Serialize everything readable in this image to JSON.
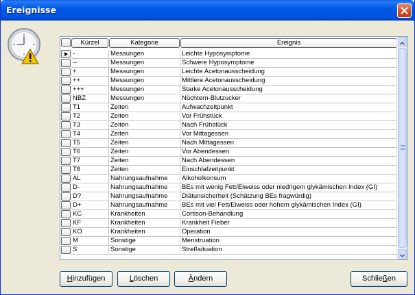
{
  "window": {
    "title": "Ereignisse"
  },
  "icons": {
    "dialog": "clock-warning-icon",
    "close": "close-icon",
    "row_pointer": "row-pointer-icon"
  },
  "table": {
    "columns": [
      "Kürzel",
      "Kategorie",
      "Ereignis"
    ],
    "current_row_index": 0,
    "rows": [
      {
        "code": "-",
        "category": "Messungen",
        "event": "Leichte Hyposymptome"
      },
      {
        "code": "--",
        "category": "Messungen",
        "event": "Schwere Hyposymptome"
      },
      {
        "code": "+",
        "category": "Messungen",
        "event": "Leichte Acetonausscheidung"
      },
      {
        "code": "++",
        "category": "Messungen",
        "event": "Mittlere Acetonausscheidung"
      },
      {
        "code": "+++",
        "category": "Messungen",
        "event": "Starke Acetonausscheidung"
      },
      {
        "code": "NBZ",
        "category": "Messungen",
        "event": "Nüchtern-Blutzucker"
      },
      {
        "code": "T1",
        "category": "Zeiten",
        "event": "Aufwachzeitpunkt"
      },
      {
        "code": "T2",
        "category": "Zeiten",
        "event": "Vor Frühstück"
      },
      {
        "code": "T3",
        "category": "Zeiten",
        "event": "Nach Frühstück"
      },
      {
        "code": "T4",
        "category": "Zeiten",
        "event": "Vor Mittagessen"
      },
      {
        "code": "T5",
        "category": "Zeiten",
        "event": "Nach Mittagessen"
      },
      {
        "code": "T6",
        "category": "Zeiten",
        "event": "Vor Abendessen"
      },
      {
        "code": "T7",
        "category": "Zeiten",
        "event": "Nach Abendessen"
      },
      {
        "code": "T8",
        "category": "Zeiten",
        "event": "Einschlafzeitpunkt"
      },
      {
        "code": "AL",
        "category": "Nahrungsaufnahme",
        "event": "Alkoholkonsum"
      },
      {
        "code": "D-",
        "category": "Nahrungsaufnahme",
        "event": "BEs mit wenig Fett/Eiweiss oder niedrigem glykämischen Index (GI)"
      },
      {
        "code": "D?",
        "category": "Nahrungsaufnahme",
        "event": "Diätunsicherheit (Schätzung BEs fragwürdig)"
      },
      {
        "code": "D+",
        "category": "Nahrungsaufnahme",
        "event": "BEs mit viel Fett/Eiweiss oder hohem glykämischen Index (GI)"
      },
      {
        "code": "KC",
        "category": "Krankheiten",
        "event": "Cortison-Behandlung"
      },
      {
        "code": "KF",
        "category": "Krankheiten",
        "event": "Krankheit Fieber"
      },
      {
        "code": "KO",
        "category": "Krankheiten",
        "event": "Operation"
      },
      {
        "code": "M",
        "category": "Sonstige",
        "event": "Menstruation"
      },
      {
        "code": "S",
        "category": "Sonstige",
        "event": "Streßsituation"
      }
    ]
  },
  "buttons": {
    "add": {
      "pre": "",
      "hot": "H",
      "post": "inzufügen"
    },
    "delete": {
      "pre": "",
      "hot": "L",
      "post": "öschen"
    },
    "edit": {
      "pre": "",
      "hot": "Ä",
      "post": "ndern"
    },
    "close": {
      "pre": "Schlie",
      "hot": "ß",
      "post": "en"
    }
  }
}
